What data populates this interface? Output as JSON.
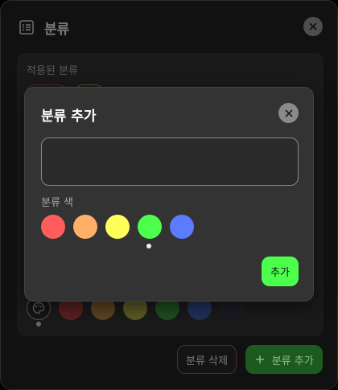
{
  "panel": {
    "title": "분류",
    "applied_label": "적용된 분류",
    "delete_label": "분류 삭제",
    "add_category_label": "분류 추가",
    "add_icon": "+",
    "colors_dimmed": [
      "#5a2020",
      "#5c4422",
      "#5a5a24",
      "#1f4d1f",
      "#22305a",
      "#1b1b22"
    ]
  },
  "dialog": {
    "title": "분류 추가",
    "input_value": "",
    "input_placeholder": "",
    "color_label": "분류 색",
    "colors": [
      "#ff5c5c",
      "#ffb066",
      "#ffff5c",
      "#4cff4c",
      "#5c7cff"
    ],
    "selected_color_index": 3,
    "add_label": "추가"
  }
}
